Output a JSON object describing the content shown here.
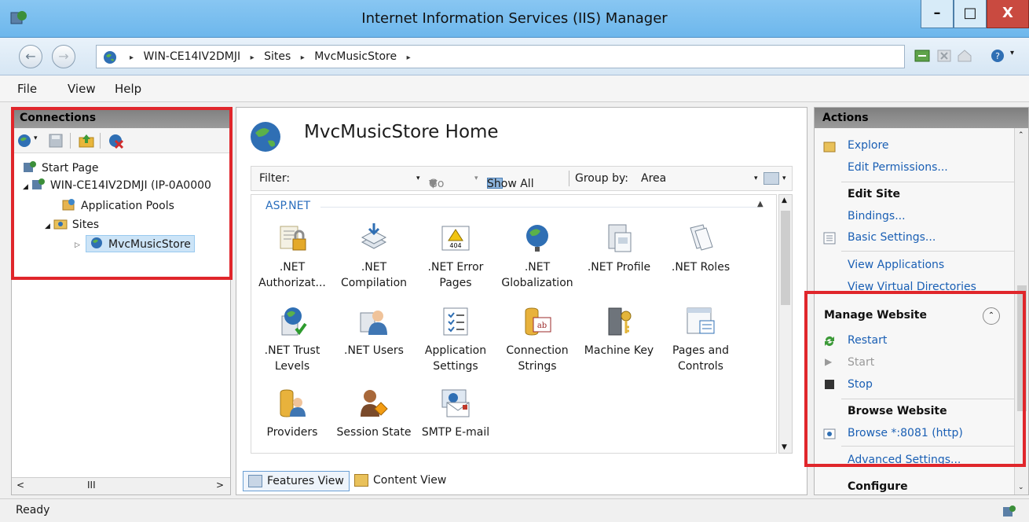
{
  "window": {
    "title": "Internet Information Services (IIS) Manager",
    "min_label": "–",
    "max_label": "□",
    "close_label": "X"
  },
  "address": {
    "crumbs": [
      "WIN-CE14IV2DMJI",
      "Sites",
      "MvcMusicStore"
    ],
    "separator": "▸"
  },
  "menu": {
    "file": "File",
    "view": "View",
    "help": "Help"
  },
  "connections": {
    "header": "Connections",
    "tree": {
      "start_page": "Start Page",
      "server": "WIN-CE14IV2DMJI (IP-0A0000",
      "app_pools": "Application Pools",
      "sites": "Sites",
      "site": "MvcMusicStore"
    },
    "scroll_label": "III"
  },
  "center": {
    "title": "MvcMusicStore Home",
    "filter_label": "Filter:",
    "go_label": "Go",
    "show_all_label": "Show All",
    "group_by_label": "Group by:",
    "group_by_value": "Area",
    "group_name": "ASP.NET",
    "features": [
      {
        "line1": ".NET",
        "line2": "Authorizat...",
        "icon": "authorization-icon"
      },
      {
        "line1": ".NET",
        "line2": "Compilation",
        "icon": "compilation-icon"
      },
      {
        "line1": ".NET Error",
        "line2": "Pages",
        "icon": "error-pages-icon"
      },
      {
        "line1": ".NET",
        "line2": "Globalization",
        "icon": "globalization-icon"
      },
      {
        "line1": ".NET Profile",
        "line2": "",
        "icon": "profile-icon"
      },
      {
        "line1": ".NET Roles",
        "line2": "",
        "icon": "roles-icon"
      },
      {
        "line1": ".NET Trust",
        "line2": "Levels",
        "icon": "trust-levels-icon"
      },
      {
        "line1": ".NET Users",
        "line2": "",
        "icon": "users-icon"
      },
      {
        "line1": "Application",
        "line2": "Settings",
        "icon": "app-settings-icon"
      },
      {
        "line1": "Connection",
        "line2": "Strings",
        "icon": "connection-strings-icon"
      },
      {
        "line1": "Machine Key",
        "line2": "",
        "icon": "machine-key-icon"
      },
      {
        "line1": "Pages and",
        "line2": "Controls",
        "icon": "pages-controls-icon"
      },
      {
        "line1": "Providers",
        "line2": "",
        "icon": "providers-icon"
      },
      {
        "line1": "Session State",
        "line2": "",
        "icon": "session-state-icon"
      },
      {
        "line1": "SMTP E-mail",
        "line2": "",
        "icon": "smtp-email-icon"
      }
    ],
    "features_view_label": "Features View",
    "content_view_label": "Content View"
  },
  "actions": {
    "header": "Actions",
    "explore": "Explore",
    "edit_permissions": "Edit Permissions...",
    "edit_site": "Edit Site",
    "bindings": "Bindings...",
    "basic_settings": "Basic Settings...",
    "view_applications": "View Applications",
    "view_virtual_directories": "View Virtual Directories",
    "manage_website": "Manage Website",
    "restart": "Restart",
    "start": "Start",
    "stop": "Stop",
    "browse_website": "Browse Website",
    "browse_8081": "Browse *:8081 (http)",
    "advanced_settings": "Advanced Settings...",
    "configure": "Configure"
  },
  "status": {
    "text": "Ready"
  },
  "colors": {
    "link": "#1a5fb4",
    "highlight": "#e0262b",
    "titlebar": "#7fc0ef"
  }
}
